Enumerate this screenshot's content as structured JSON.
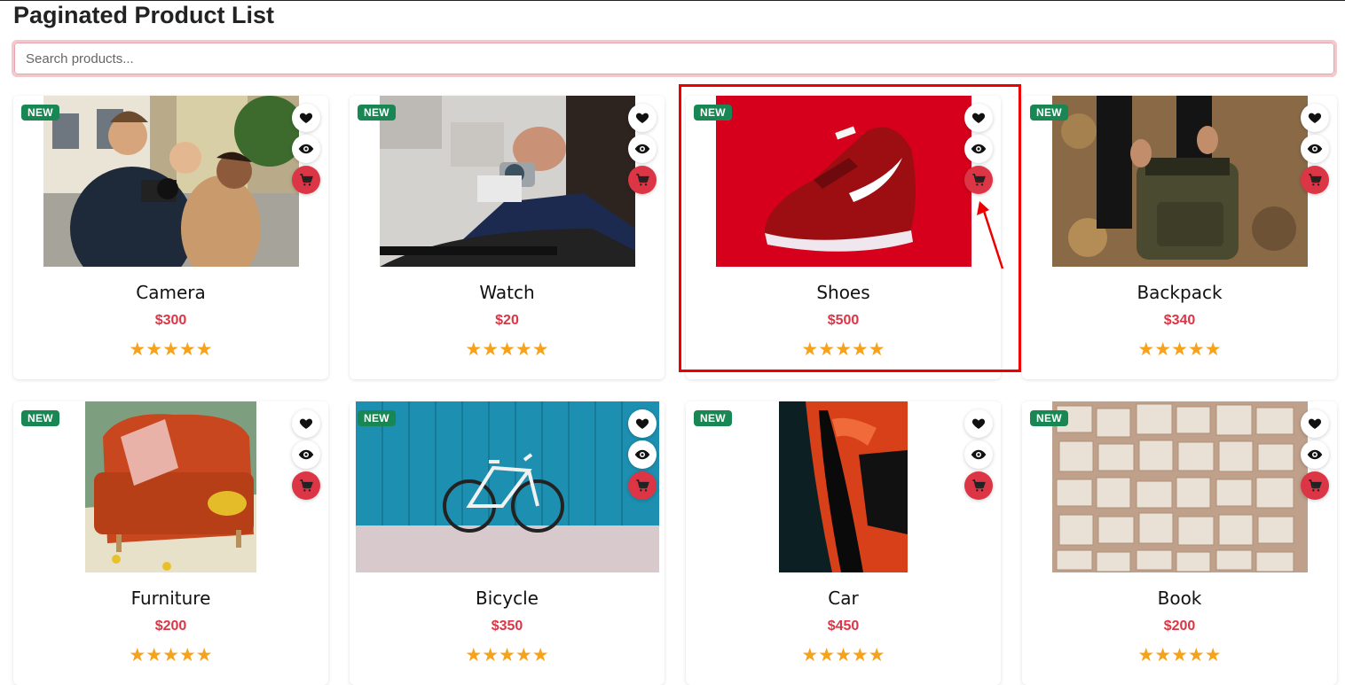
{
  "page": {
    "title": "Paginated Product List"
  },
  "search": {
    "placeholder": "Search products..."
  },
  "badge_label": "NEW",
  "colors": {
    "badge": "#198754",
    "price": "#dc3545",
    "cart_button": "#dc3545",
    "stars": "#f7a21b",
    "highlight": "#e00000"
  },
  "icons": {
    "wishlist": "heart-icon",
    "quick_view": "eye-icon",
    "add_to_cart": "cart-icon",
    "rating": "star-icon"
  },
  "products": [
    {
      "name": "Camera",
      "price": "$300",
      "rating": 5,
      "badge": "NEW"
    },
    {
      "name": "Watch",
      "price": "$20",
      "rating": 5,
      "badge": "NEW"
    },
    {
      "name": "Shoes",
      "price": "$500",
      "rating": 5,
      "badge": "NEW"
    },
    {
      "name": "Backpack",
      "price": "$340",
      "rating": 5,
      "badge": "NEW"
    },
    {
      "name": "Furniture",
      "price": "$200",
      "rating": 5,
      "badge": "NEW"
    },
    {
      "name": "Bicycle",
      "price": "$350",
      "rating": 5,
      "badge": "NEW"
    },
    {
      "name": "Car",
      "price": "$450",
      "rating": 5,
      "badge": "NEW"
    },
    {
      "name": "Book",
      "price": "$200",
      "rating": 5,
      "badge": "NEW"
    }
  ]
}
